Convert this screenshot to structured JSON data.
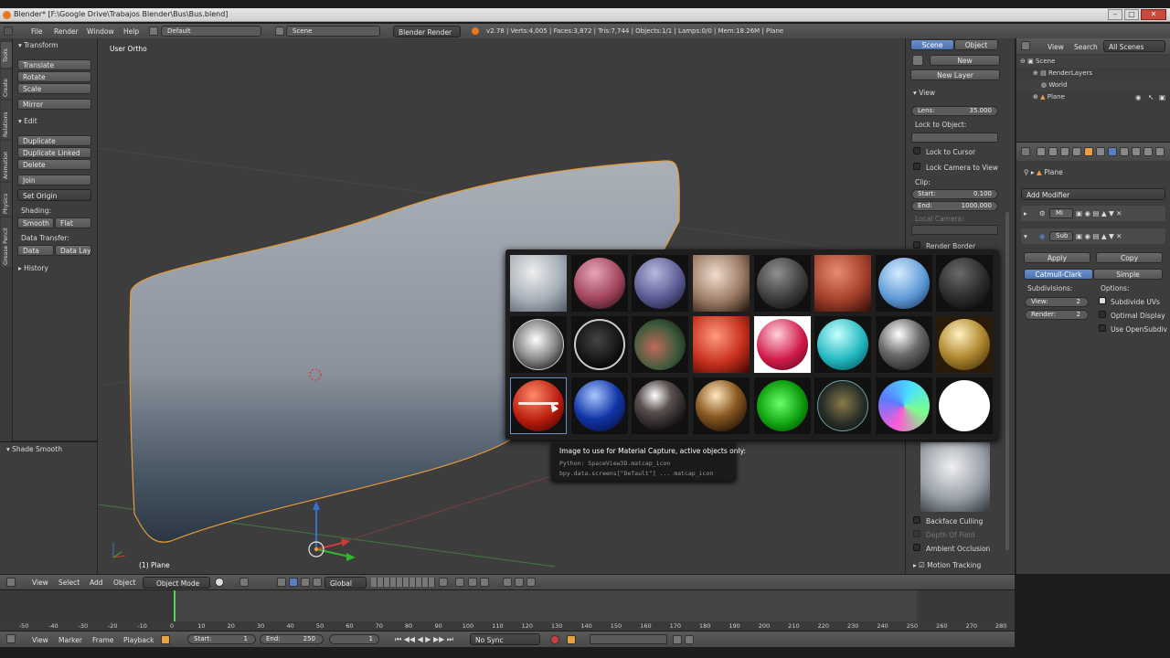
{
  "titlebar": {
    "title": "Blender* [F:\\Google Drive\\Trabajos Blender\\Bus\\Bus.blend]"
  },
  "topbar": {
    "menus": [
      "File",
      "Render",
      "Window",
      "Help"
    ],
    "screen": "Default",
    "scene": "Scene",
    "engine": "Blender Render",
    "stats": "v2.78 | Verts:4,005 | Faces:3,872 | Tris:7,744 | Objects:1/1 | Lamps:0/0 | Mem:18.26M | Plane"
  },
  "toolshelf": {
    "tabs": [
      "Tools",
      "Create",
      "Relations",
      "Animation",
      "Physics",
      "Grease Pencil"
    ],
    "transform_header": "Transform",
    "transform_buttons": [
      "Translate",
      "Rotate",
      "Scale",
      "Mirror"
    ],
    "edit_header": "Edit",
    "edit_buttons": [
      "Duplicate",
      "Duplicate Linked",
      "Delete",
      "Join"
    ],
    "set_origin": "Set Origin",
    "shading_label": "Shading:",
    "smooth": "Smooth",
    "flat": "Flat",
    "data_transfer_label": "Data Transfer:",
    "data": "Data",
    "data_layout": "Data Layo",
    "history": "History",
    "operator_panel": "Shade Smooth"
  },
  "viewport": {
    "view_label": "User Ortho",
    "object_label": "(1) Plane"
  },
  "properties_n": {
    "tab_scene": "Scene",
    "tab_object": "Object",
    "new_button": "New",
    "new_layer": "New Layer",
    "view_header": "View",
    "lens_label": "Lens:",
    "lens_value": "35.000",
    "lock_to_object": "Lock to Object:",
    "lock_to_cursor": "Lock to Cursor",
    "lock_camera": "Lock Camera to View",
    "clip_label": "Clip:",
    "clip_start_label": "Start:",
    "clip_start_value": "0.100",
    "clip_end_label": "End:",
    "clip_end_value": "1000.000",
    "local_camera": "Local Camera:",
    "render_border": "Render Border",
    "backface_culling": "Backface Culling",
    "depth_of_field": "Depth Of Field",
    "ambient_occlusion": "Ambient Occlusion",
    "motion_tracking": "Motion Tracking"
  },
  "matcap_tooltip": {
    "line1": "Image to use for Material Capture, active objects only:",
    "line2": "Python: SpaceView3D.matcap_icon",
    "line3": "bpy.data.screens[\"Default\"] ... matcap_icon"
  },
  "outliner": {
    "menus": [
      "View",
      "Search"
    ],
    "filter": "All Scenes",
    "items": [
      "Scene",
      "RenderLayers",
      "World",
      "Plane"
    ]
  },
  "modifier_panel": {
    "object_name": "Plane",
    "add_modifier": "Add Modifier",
    "mod1_name": "Mi",
    "mod2_name": "Sub",
    "apply": "Apply",
    "copy": "Copy",
    "catmull": "Catmull-Clark",
    "simple": "Simple",
    "subdivisions_label": "Subdivisions:",
    "options_label": "Options:",
    "view_label": "View:",
    "view_value": "2",
    "render_label": "Render:",
    "render_value": "2",
    "subdivide_uvs": "Subdivide UVs",
    "optimal_display": "Optimal Display",
    "use_opensubdiv": "Use OpenSubdiv"
  },
  "viewport_header": {
    "menus": [
      "View",
      "Select",
      "Add",
      "Object"
    ],
    "mode": "Object Mode",
    "orientation": "Global"
  },
  "timeline": {
    "ticks": [
      "-50",
      "-40",
      "-30",
      "-20",
      "-10",
      "0",
      "10",
      "20",
      "30",
      "40",
      "50",
      "60",
      "70",
      "80",
      "90",
      "100",
      "110",
      "120",
      "130",
      "140",
      "150",
      "160",
      "170",
      "180",
      "190",
      "200",
      "210",
      "220",
      "230",
      "240",
      "250",
      "260",
      "270",
      "280"
    ],
    "menus": [
      "View",
      "Marker",
      "Frame",
      "Playback"
    ],
    "start_label": "Start:",
    "start_value": "1",
    "end_label": "End:",
    "end_value": "250",
    "current_frame": "1",
    "sync": "No Sync"
  },
  "colors": {
    "accent": "#5680c2",
    "selection": "#f0a040",
    "header": "#4a4a4a",
    "viewport": "#3c3c3c"
  }
}
